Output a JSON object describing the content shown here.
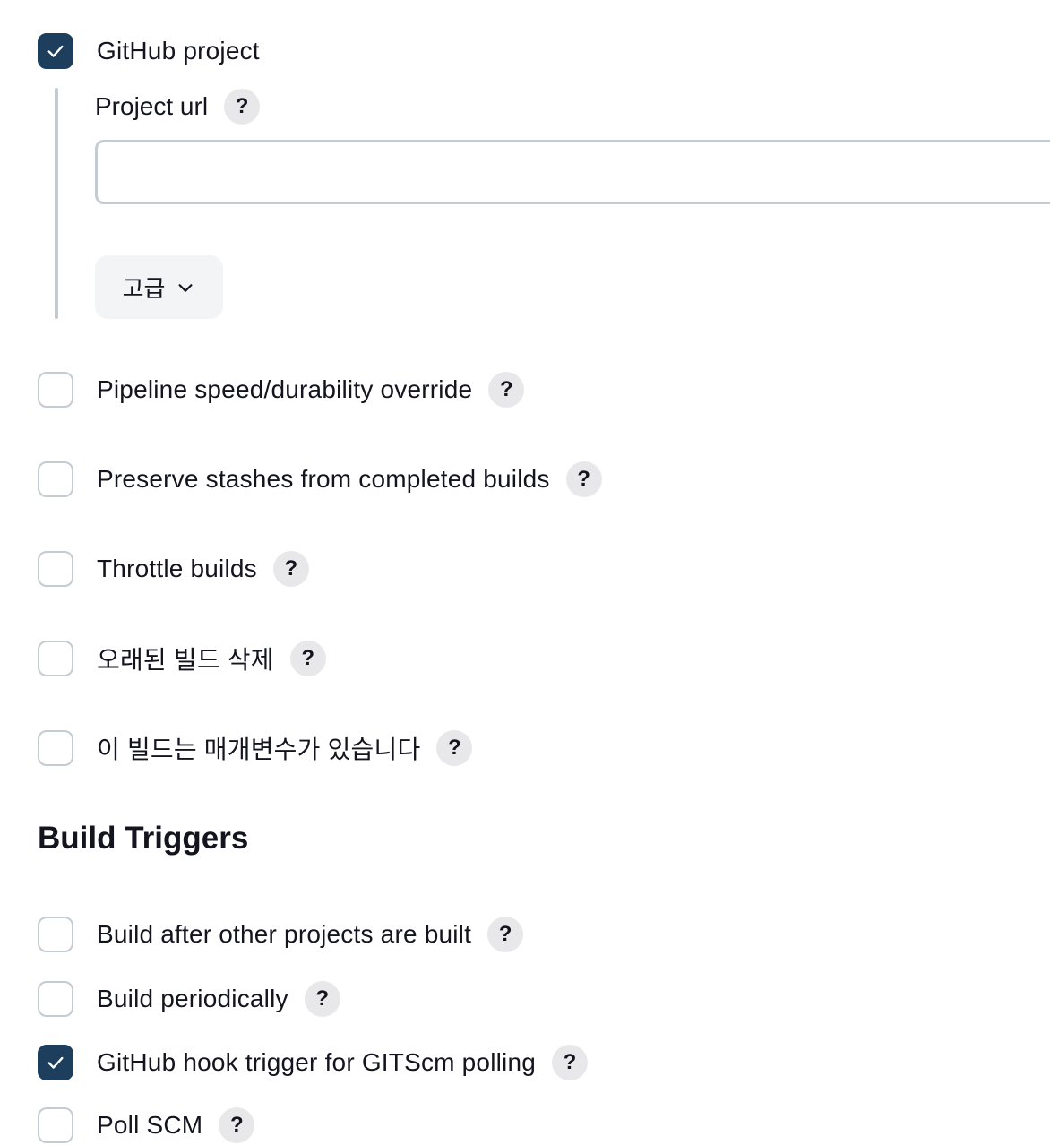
{
  "general": {
    "github_project": {
      "label": "GitHub project",
      "checked": true,
      "project_url": {
        "label": "Project url",
        "help": "?",
        "value": "",
        "placeholder": ""
      },
      "advanced_label": "고급",
      "advanced_icon": "chevron-down-icon"
    },
    "options": [
      {
        "label": "Pipeline speed/durability override",
        "help": "?",
        "checked": false
      },
      {
        "label": "Preserve stashes from completed builds",
        "help": "?",
        "checked": false
      },
      {
        "label": "Throttle builds",
        "help": "?",
        "checked": false
      },
      {
        "label": "오래된 빌드 삭제",
        "help": "?",
        "checked": false
      },
      {
        "label": "이 빌드는 매개변수가 있습니다",
        "help": "?",
        "checked": false
      }
    ]
  },
  "build_triggers": {
    "heading": "Build Triggers",
    "options": [
      {
        "label": "Build after other projects are built",
        "help": "?",
        "checked": false
      },
      {
        "label": "Build periodically",
        "help": "?",
        "checked": false
      },
      {
        "label": "GitHub hook trigger for GITScm polling",
        "help": "?",
        "checked": true
      },
      {
        "label": "Poll SCM",
        "help": "?",
        "checked": false
      }
    ]
  },
  "colors": {
    "checkbox_checked": "#1d3e5c",
    "checkbox_border": "#c5cbd2",
    "help_bg": "#e8e8ea",
    "advanced_bg": "#f3f4f6",
    "text": "#14141f"
  }
}
